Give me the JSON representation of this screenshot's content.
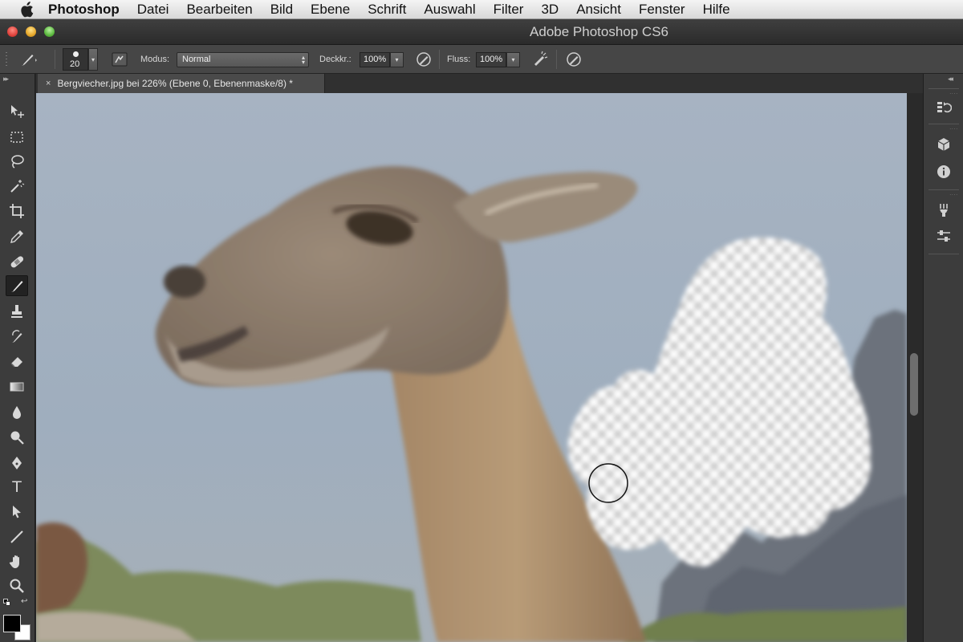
{
  "menubar": {
    "app_name": "Photoshop",
    "items": [
      "Datei",
      "Bearbeiten",
      "Bild",
      "Ebene",
      "Schrift",
      "Auswahl",
      "Filter",
      "3D",
      "Ansicht",
      "Fenster",
      "Hilfe"
    ]
  },
  "window": {
    "title": "Adobe Photoshop CS6"
  },
  "options_bar": {
    "brush_size": "20",
    "mode_label": "Modus:",
    "mode_value": "Normal",
    "opacity_label": "Deckkr.:",
    "opacity_value": "100%",
    "flow_label": "Fluss:",
    "flow_value": "100%"
  },
  "document": {
    "tab_close": "×",
    "tab_title": "Bergviecher.jpg bei 226% (Ebene 0, Ebenenmaske/8) *"
  },
  "tools": {
    "type_tool": "T"
  },
  "colors": {
    "foreground": "#000000",
    "background": "#ffffff"
  }
}
